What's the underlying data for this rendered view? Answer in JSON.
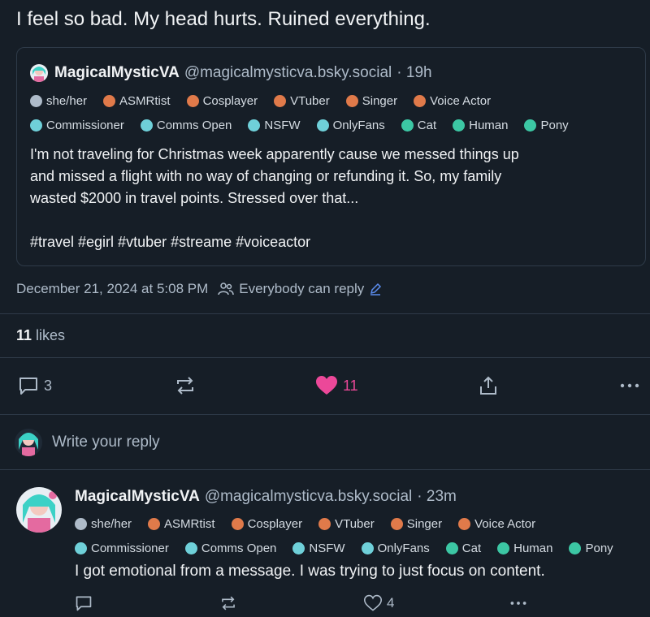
{
  "post": {
    "text": "I feel so bad. My head hurts. Ruined everything.",
    "date": "December 21, 2024 at 5:08 PM",
    "reply_setting": "Everybody can reply",
    "likes_count": "11",
    "likes_label": "likes"
  },
  "quote": {
    "display_name": "MagicalMysticVA",
    "handle": "@magicalmysticva.bsky.social",
    "time": "· 19h",
    "labels_row1": [
      "she/her",
      "ASMRtist",
      "Cosplayer",
      "VTuber",
      "Singer",
      "Voice Actor"
    ],
    "labels_row2": [
      "Commissioner",
      "Comms Open",
      "NSFW",
      "OnlyFans",
      "Cat",
      "Human",
      "Pony"
    ],
    "body_line1": "I'm not traveling for Christmas week apparently cause we messed things up",
    "body_line2": "and missed a flight with no way of changing or refunding it. So, my family",
    "body_line3": "wasted $2000 in travel points. Stressed over that...",
    "hashtags": "#travel #egirl #vtuber #streame #voiceactor"
  },
  "actions": {
    "reply_count": "3",
    "like_count": "11",
    "like_color": "#ec4899"
  },
  "compose": {
    "placeholder": "Write your reply"
  },
  "reply": {
    "display_name": "MagicalMysticVA",
    "handle": "@magicalmysticva.bsky.social",
    "time": "· 23m",
    "text": "I got emotional from a message. I was trying to just focus on content.",
    "like_count": "4"
  }
}
